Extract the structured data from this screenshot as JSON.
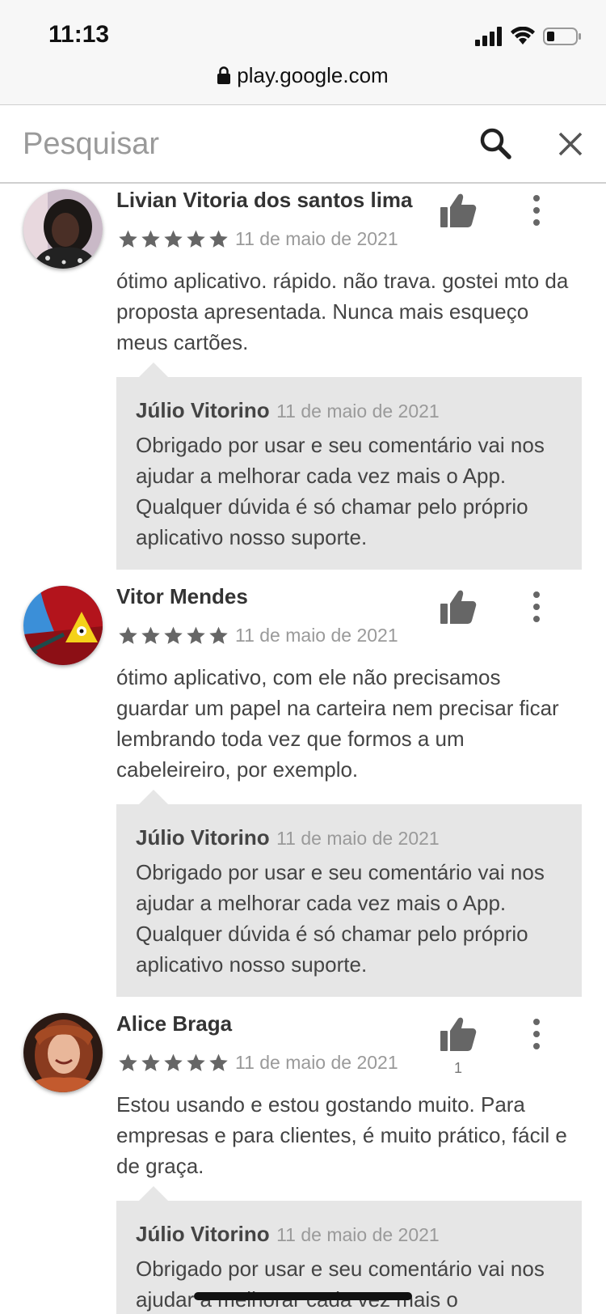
{
  "status": {
    "time": "11:13",
    "url": "play.google.com"
  },
  "search": {
    "placeholder": "Pesquisar"
  },
  "reviews": [
    {
      "author": "Livian Vitoria dos santos lima",
      "stars": 5,
      "date": "11 de maio de 2021",
      "likes": "",
      "text": "ótimo aplicativo. rápido. não trava. gostei mto da proposta apresentada. Nunca mais esqueço meus cartões.",
      "reply": {
        "author": "Júlio Vitorino",
        "date": "11 de maio de 2021",
        "text": "Obrigado por usar e seu comentário vai nos ajudar a melhorar cada vez mais o App. Qualquer dúvida é só chamar pelo próprio aplicativo nosso suporte."
      }
    },
    {
      "author": "Vitor Mendes",
      "stars": 5,
      "date": "11 de maio de 2021",
      "likes": "",
      "text": "ótimo aplicativo, com ele não precisamos guardar um papel na carteira nem precisar ficar lembrando toda vez que formos a um cabeleireiro, por exemplo.",
      "reply": {
        "author": "Júlio Vitorino",
        "date": "11 de maio de 2021",
        "text": "Obrigado por usar e seu comentário vai nos ajudar a melhorar cada vez mais o App. Qualquer dúvida é só chamar pelo próprio aplicativo nosso suporte."
      }
    },
    {
      "author": "Alice Braga",
      "stars": 5,
      "date": "11 de maio de 2021",
      "likes": "1",
      "text": "Estou usando e estou gostando muito. Para empresas e para clientes, é muito prático, fácil e de graça.",
      "reply": {
        "author": "Júlio Vitorino",
        "date": "11 de maio de 2021",
        "text": "Obrigado por usar e seu comentário vai nos ajudar a melhorar cada vez mais o"
      }
    }
  ],
  "colors": {
    "reply_bg": "#e6e6e6",
    "star": "#666666",
    "date": "#9a9a9a"
  },
  "icons": [
    "lock-icon",
    "signal-icon",
    "wifi-icon",
    "battery-icon",
    "search-icon",
    "close-icon",
    "star-icon",
    "thumbs-up-icon",
    "more-vert-icon"
  ]
}
